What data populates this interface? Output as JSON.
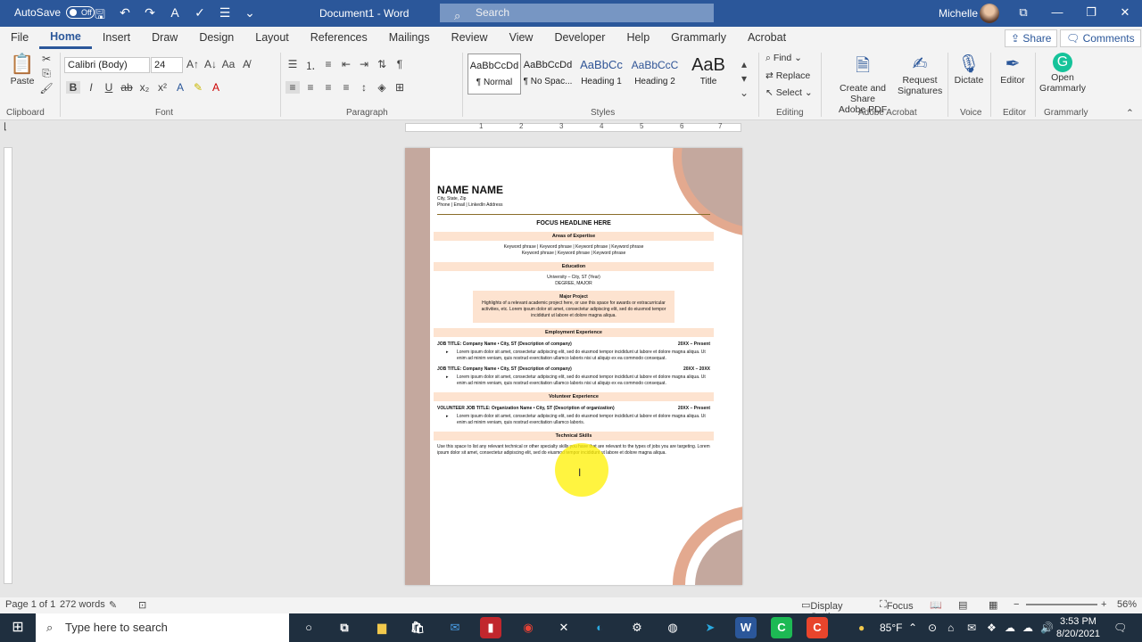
{
  "titlebar": {
    "autosave_label": "AutoSave",
    "autosave_state": "Off",
    "doc_title": "Document1 - Word",
    "search_placeholder": "Search",
    "user_name": "Michelle"
  },
  "tabs": [
    "File",
    "Home",
    "Insert",
    "Draw",
    "Design",
    "Layout",
    "References",
    "Mailings",
    "Review",
    "View",
    "Developer",
    "Help",
    "Grammarly",
    "Acrobat"
  ],
  "share_label": "Share",
  "comments_label": "Comments",
  "ribbon": {
    "paste": "Paste",
    "clipboard": "Clipboard",
    "font_name": "Calibri (Body)",
    "font_size": "24",
    "font": "Font",
    "paragraph": "Paragraph",
    "styles_label": "Styles",
    "styles": [
      {
        "preview": "AaBbCcDd",
        "name": "¶ Normal"
      },
      {
        "preview": "AaBbCcDd",
        "name": "¶ No Spac..."
      },
      {
        "preview": "AaBbCc",
        "name": "Heading 1"
      },
      {
        "preview": "AaBbCcC",
        "name": "Heading 2"
      },
      {
        "preview": "AaB",
        "name": "Title"
      }
    ],
    "find": "Find",
    "replace": "Replace",
    "select": "Select",
    "editing": "Editing",
    "create_share_1": "Create and Share",
    "create_share_2": "Adobe PDF",
    "request_sig_1": "Request",
    "request_sig_2": "Signatures",
    "adobe_acrobat": "Adobe Acrobat",
    "dictate": "Dictate",
    "voice": "Voice",
    "editor": "Editor",
    "editor_group": "Editor",
    "open_grammarly_1": "Open",
    "open_grammarly_2": "Grammarly",
    "grammarly_group": "Grammarly"
  },
  "document": {
    "name": "NAME NAME",
    "location": "City, State, Zip",
    "contact": "Phone | Email | LinkedIn Address",
    "headline": "FOCUS HEADLINE HERE",
    "areas_title": "Areas of Expertise",
    "keywords_1": "Keyword phrase | Keyword phrase | Keyword phrase | Keyword phrase",
    "keywords_2": "Keyword phrase | Keyword phrase | Keyword phrase",
    "education_title": "Education",
    "university": "University – City, ST (Year)",
    "degree": "DEGREE, MAJOR",
    "project_title": "Major Project",
    "project_text": "Highlights of a relevant academic project here, or use this space for awards or extracurricular activities, etc. Lorem ipsum dolor sit amet, consectetur adipiscing elit, sed do eiusmod tempor incididunt ut labore et dolore magna aliqua.",
    "employment_title": "Employment Experience",
    "job1_title": "JOB TITLE: Company Name • City, ST (Description of company)",
    "job1_date": "20XX – Present",
    "job1_bullet": "Lorem ipsum dolor sit amet, consectetur adipiscing elit, sed do eiusmod tempor incididunt ut labore et dolore magna aliqua. Ut enim ad minim veniam, quis nostrud exercitation ullamco laboris nisi ut aliquip ex ea commodo consequat.",
    "job2_title": "JOB TITLE: Company Name • City, ST (Description of company)",
    "job2_date": "20XX – 20XX",
    "job2_bullet": "Lorem ipsum dolor sit amet, consectetur adipiscing elit, sed do eiusmod tempor incididunt ut labore et dolore magna aliqua. Ut enim ad minim veniam, quis nostrud exercitation ullamco laboris nisi ut aliquip ex ea commodo consequat.",
    "volunteer_title": "Volunteer Experience",
    "vol_title": "VOLUNTEER JOB TITLE: Organization Name • City, ST (Description of organization)",
    "vol_date": "20XX – Present",
    "vol_bullet": "Lorem ipsum dolor sit amet, consectetur adipiscing elit, sed do eiusmod tempor incididunt ut labore et dolore magna aliqua. Ut enim ad minim veniam, quis nostrud exercitation ullamco laboris.",
    "skills_title": "Technical Skills",
    "skills_text": "Use this space to list any relevant technical or other specialty skills you have that are relevant to the types of jobs you are targeting. Lorem ipsum dolor sit amet, consectetur adipiscing elit, sed do eiusmod tempor incididunt ut labore et dolore magna aliqua."
  },
  "ruler_numbers": [
    "1",
    "2",
    "3",
    "4",
    "5",
    "6",
    "7"
  ],
  "status": {
    "page": "Page 1 of 1",
    "words": "272 words",
    "display_settings": "Display Settings",
    "focus": "Focus",
    "zoom": "56%"
  },
  "taskbar": {
    "search_placeholder": "Type here to search",
    "weather": "85°F",
    "time": "3:53 PM",
    "date": "8/20/2021"
  }
}
